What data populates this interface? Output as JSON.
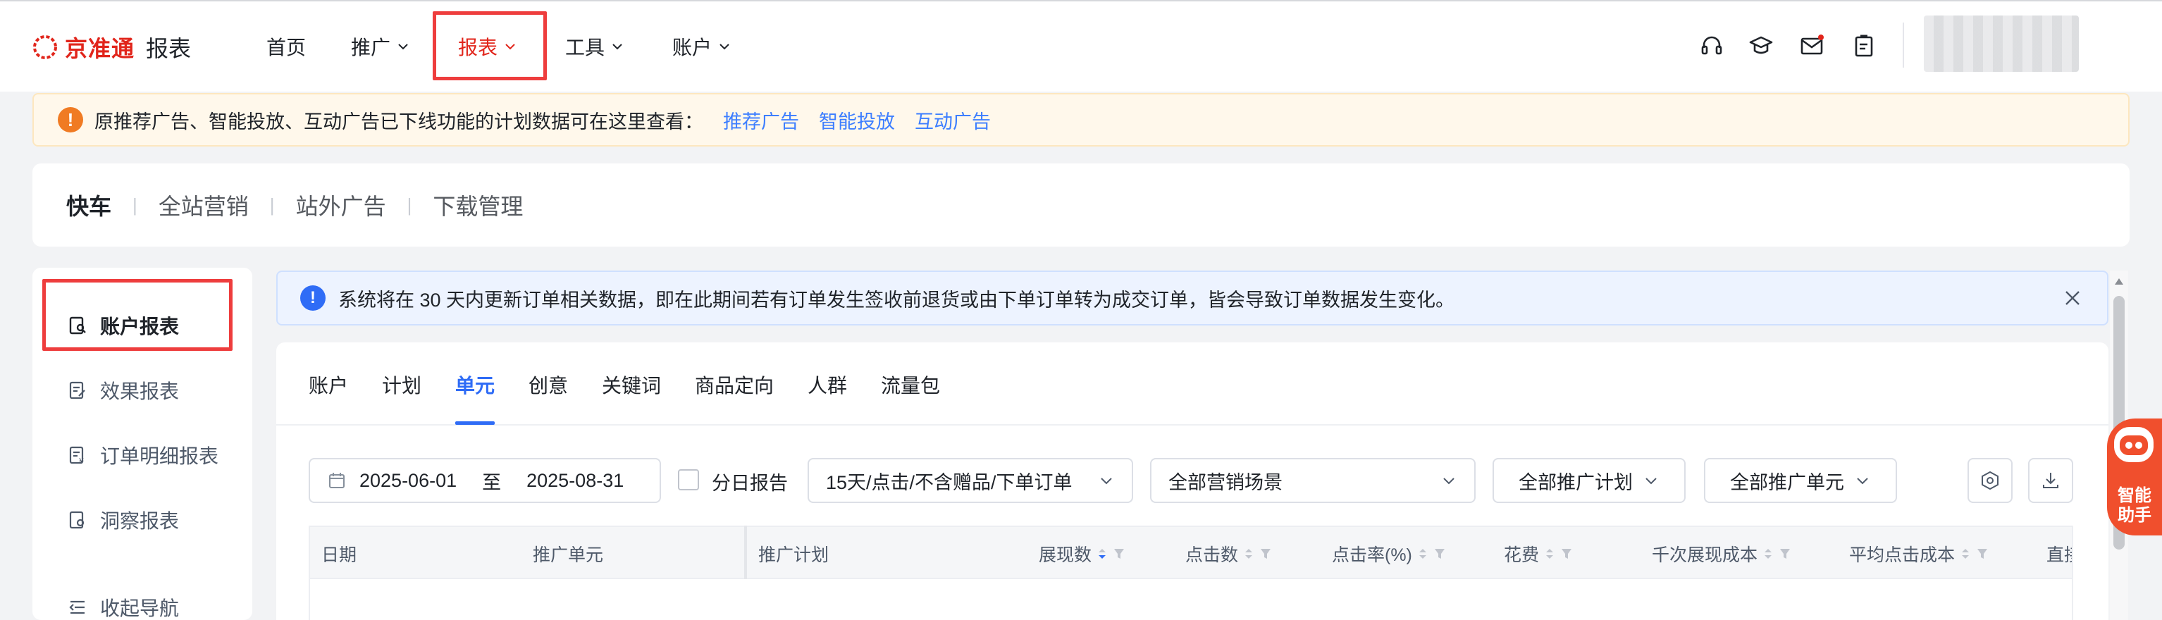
{
  "topnav": {
    "logo_text": "京准通",
    "logo_sub": "报表",
    "items": [
      {
        "label": "首页"
      },
      {
        "label": "推广"
      },
      {
        "label": "报表"
      },
      {
        "label": "工具"
      },
      {
        "label": "账户"
      }
    ],
    "icons": [
      "headset-icon",
      "graduation-cap-icon",
      "mail-icon",
      "clipboard-icon"
    ]
  },
  "notice": {
    "text": "原推荐广告、智能投放、互动广告已下线功能的计划数据可在这里查看：",
    "links": [
      "推荐广告",
      "智能投放",
      "互动广告"
    ]
  },
  "channels": [
    "快车",
    "全站营销",
    "站外广告",
    "下载管理"
  ],
  "sidebar": {
    "items": [
      {
        "label": "账户报表"
      },
      {
        "label": "效果报表"
      },
      {
        "label": "订单明细报表"
      },
      {
        "label": "洞察报表"
      },
      {
        "label": "收起导航"
      }
    ]
  },
  "info_banner": {
    "text": "系统将在 30 天内更新订单相关数据，即在此期间若有订单发生签收前退货或由下单订单转为成交订单，皆会导致订单数据发生变化。"
  },
  "subtabs": [
    "账户",
    "计划",
    "单元",
    "创意",
    "关键词",
    "商品定向",
    "人群",
    "流量包"
  ],
  "filters": {
    "date_start": "2025-06-01",
    "date_sep": "至",
    "date_end": "2025-08-31",
    "daily_report": "分日报告",
    "attribution": "15天/点击/不含赠品/下单订单",
    "scene": "全部营销场景",
    "plan": "全部推广计划",
    "unit": "全部推广单元"
  },
  "table": {
    "headers": [
      "日期",
      "推广单元",
      "推广计划",
      "展现数",
      "点击数",
      "点击率(%)",
      "花费",
      "千次展现成本",
      "平均点击成本",
      "直接"
    ]
  },
  "assistant": {
    "line1": "智能",
    "line2": "助手"
  },
  "colors": {
    "brand": "#e1251b",
    "accent": "#2f6cf6",
    "highlight": "#ee3d3d"
  }
}
